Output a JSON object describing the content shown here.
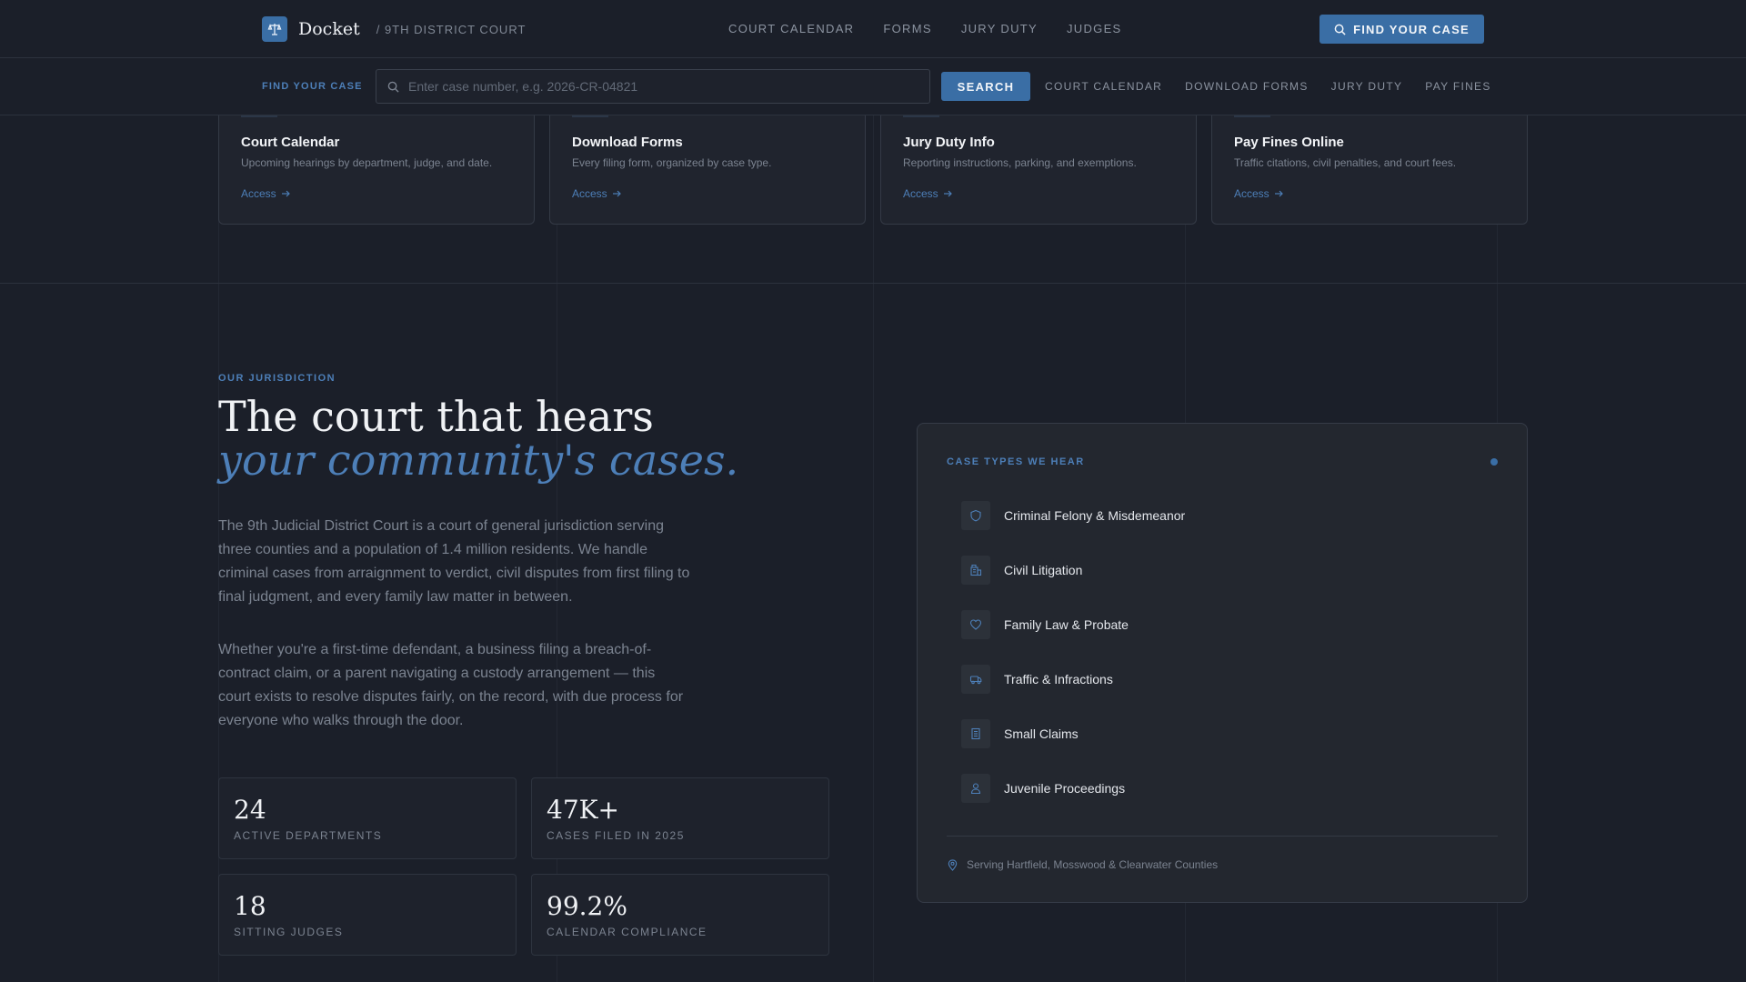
{
  "header": {
    "brand": "Docket",
    "court": "/ 9TH DISTRICT COURT",
    "nav": [
      "COURT CALENDAR",
      "FORMS",
      "JURY DUTY",
      "JUDGES"
    ],
    "cta_label": "FIND YOUR CASE"
  },
  "search": {
    "label": "FIND YOUR CASE",
    "placeholder": "Enter case number, e.g. 2026-CR-04821",
    "button": "SEARCH",
    "quick_links": [
      "COURT CALENDAR",
      "DOWNLOAD FORMS",
      "JURY DUTY",
      "PAY FINES"
    ]
  },
  "services": [
    {
      "title": "Court Calendar",
      "desc": "Upcoming hearings by department, judge, and date.",
      "link": "Access"
    },
    {
      "title": "Download Forms",
      "desc": "Every filing form, organized by case type.",
      "link": "Access"
    },
    {
      "title": "Jury Duty Info",
      "desc": "Reporting instructions, parking, and exemptions.",
      "link": "Access"
    },
    {
      "title": "Pay Fines Online",
      "desc": "Traffic citations, civil penalties, and court fees.",
      "link": "Access"
    }
  ],
  "jurisdiction": {
    "eyebrow": "OUR JURISDICTION",
    "headline_line1": "The court that hears",
    "headline_line2": "your community's cases.",
    "paragraphs": [
      "The 9th Judicial District Court is a court of general jurisdiction serving three counties and a population of 1.4 million residents. We handle criminal cases from arraignment to verdict, civil disputes from first filing to final judgment, and every family law matter in between.",
      "Whether you're a first-time defendant, a business filing a breach-of-contract claim, or a parent navigating a custody arrangement — this court exists to resolve disputes fairly, on the record, with due process for everyone who walks through the door."
    ],
    "stats": [
      {
        "value": "24",
        "label": "ACTIVE DEPARTMENTS"
      },
      {
        "value": "47K+",
        "label": "CASES FILED IN 2025"
      },
      {
        "value": "18",
        "label": "SITTING JUDGES"
      },
      {
        "value": "99.2%",
        "label": "CALENDAR COMPLIANCE"
      }
    ]
  },
  "case_types": {
    "title": "CASE TYPES WE HEAR",
    "items": [
      {
        "label": "Criminal Felony & Misdemeanor",
        "icon": "shield-icon"
      },
      {
        "label": "Civil Litigation",
        "icon": "building-icon"
      },
      {
        "label": "Family Law & Probate",
        "icon": "heart-icon"
      },
      {
        "label": "Traffic & Infractions",
        "icon": "car-icon"
      },
      {
        "label": "Small Claims",
        "icon": "receipt-icon"
      },
      {
        "label": "Juvenile Proceedings",
        "icon": "person-icon"
      }
    ],
    "footer": "Serving Hartfield, Mosswood & Clearwater Counties"
  },
  "colors": {
    "accent": "#3a6ea5",
    "accent_text": "#4d7fb8",
    "background": "#1b1f29",
    "panel": "#23272f"
  }
}
